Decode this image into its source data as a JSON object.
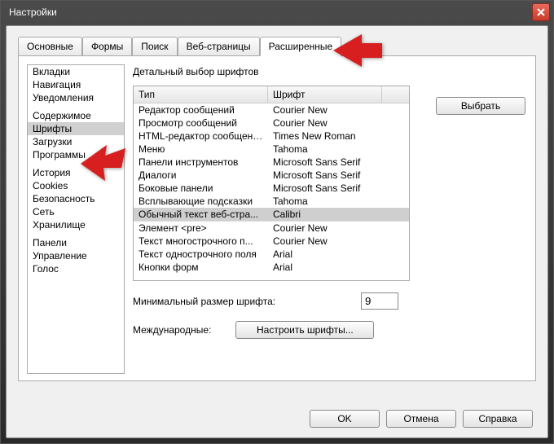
{
  "window": {
    "title": "Настройки"
  },
  "tabs": [
    {
      "label": "Основные",
      "active": false
    },
    {
      "label": "Формы",
      "active": false
    },
    {
      "label": "Поиск",
      "active": false
    },
    {
      "label": "Веб-страницы",
      "active": false
    },
    {
      "label": "Расширенные",
      "active": true
    }
  ],
  "sidebar": {
    "groups": [
      [
        "Вкладки",
        "Навигация",
        "Уведомления"
      ],
      [
        "Содержимое",
        "Шрифты",
        "Загрузки",
        "Программы"
      ],
      [
        "История",
        "Cookies",
        "Безопасность",
        "Сеть",
        "Хранилище"
      ],
      [
        "Панели",
        "Управление",
        "Голос"
      ]
    ],
    "selected": "Шрифты"
  },
  "section_title": "Детальный выбор шрифтов",
  "font_table": {
    "headers": {
      "type": "Тип",
      "font": "Шрифт"
    },
    "rows": [
      {
        "type": "Редактор сообщений",
        "font": "Courier New"
      },
      {
        "type": "Просмотр сообщений",
        "font": "Courier New"
      },
      {
        "type": "HTML-редактор сообщений",
        "font": "Times New Roman"
      },
      {
        "type": "Меню",
        "font": "Tahoma"
      },
      {
        "type": "Панели инструментов",
        "font": "Microsoft Sans Serif"
      },
      {
        "type": "Диалоги",
        "font": "Microsoft Sans Serif"
      },
      {
        "type": "Боковые панели",
        "font": "Microsoft Sans Serif"
      },
      {
        "type": "Всплывающие подсказки",
        "font": "Tahoma"
      },
      {
        "type": "Обычный текст веб-стра...",
        "font": "Calibri",
        "selected": true,
        "sep_below": true
      },
      {
        "type": "Элемент <pre>",
        "font": "Courier New"
      },
      {
        "type": "Текст многострочного п...",
        "font": "Courier New"
      },
      {
        "type": "Текст однострочного поля",
        "font": "Arial"
      },
      {
        "type": "Кнопки форм",
        "font": "Arial"
      }
    ]
  },
  "choose_button": "Выбрать",
  "min_size": {
    "label": "Минимальный размер шрифта:",
    "value": "9"
  },
  "intl": {
    "label": "Международные:",
    "button": "Настроить шрифты..."
  },
  "buttons": {
    "ok": "OK",
    "cancel": "Отмена",
    "help": "Справка"
  }
}
